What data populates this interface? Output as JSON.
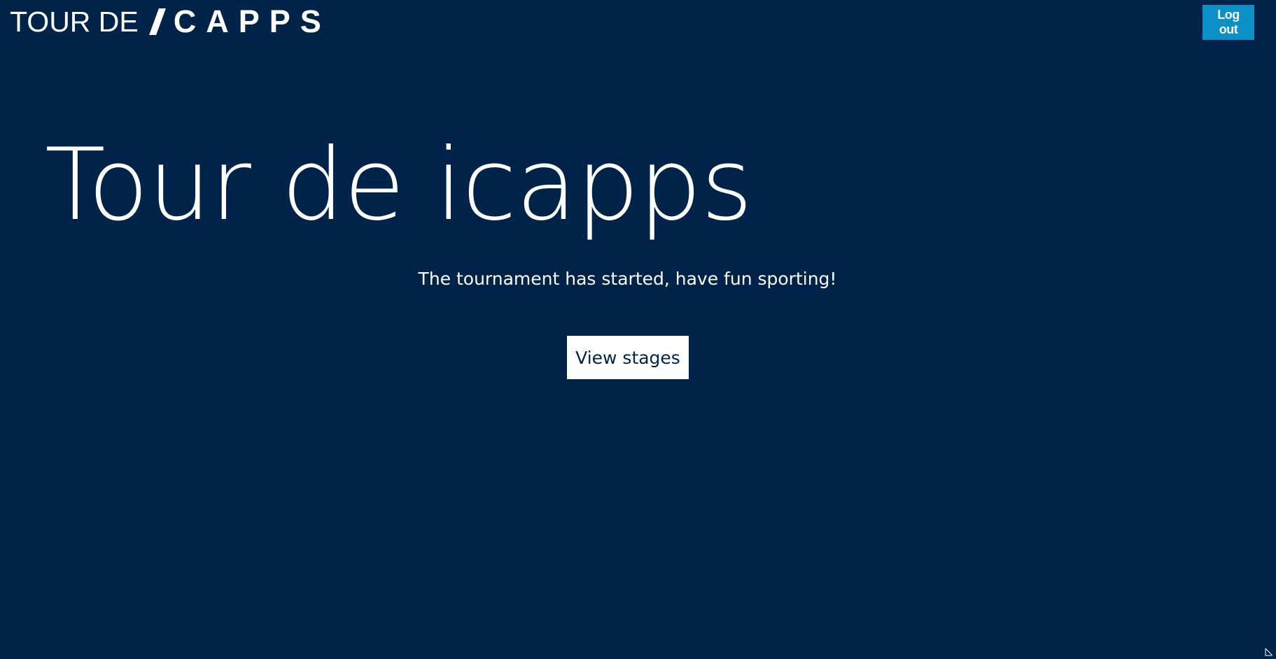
{
  "header": {
    "logo": {
      "prefix": "TOUR DE",
      "brand": "CAPPS"
    },
    "logout_label": "Log out"
  },
  "hero": {
    "title": "Tour de icapps",
    "subtitle": "The tournament has started, have fun sporting!",
    "cta_label": "View stages"
  },
  "colors": {
    "background": "#00234a",
    "accent": "#0a8fc7",
    "text": "#ffffff"
  },
  "icons": {
    "logo_slash": "slash-icon",
    "corner": "resize-grip-icon"
  }
}
